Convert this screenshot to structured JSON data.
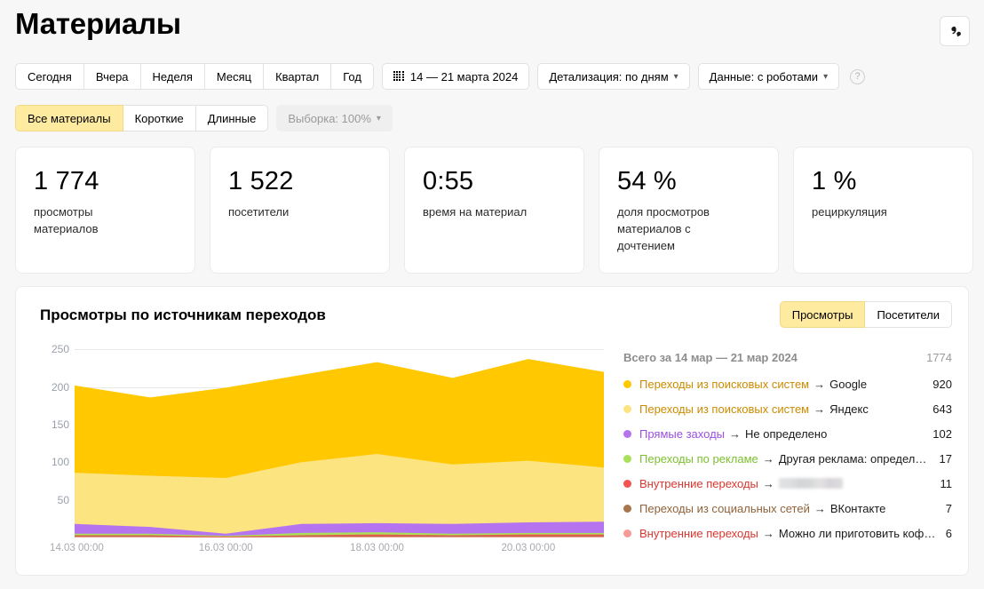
{
  "header": {
    "title": "Материалы",
    "quote_icon": "quote-icon"
  },
  "period_tabs": [
    {
      "label": "Сегодня",
      "active": false
    },
    {
      "label": "Вчера",
      "active": false
    },
    {
      "label": "Неделя",
      "active": false
    },
    {
      "label": "Месяц",
      "active": false
    },
    {
      "label": "Квартал",
      "active": false
    },
    {
      "label": "Год",
      "active": false
    }
  ],
  "date_range": {
    "icon": "calendar-icon",
    "label": "14 — 21 марта 2024"
  },
  "detail_select": {
    "label": "Детализация: по дням",
    "chevron": "chevron-down-icon"
  },
  "data_select": {
    "label": "Данные: с роботами",
    "chevron": "chevron-down-icon"
  },
  "help": {
    "icon": "help-icon",
    "glyph": "?"
  },
  "material_tabs": [
    {
      "label": "Все материалы",
      "active": true
    },
    {
      "label": "Короткие",
      "active": false
    },
    {
      "label": "Длинные",
      "active": false
    }
  ],
  "sampling": {
    "label": "Выборка: 100%",
    "chevron": "chevron-down-icon"
  },
  "kpis": [
    {
      "value": "1 774",
      "label": "просмотры материалов"
    },
    {
      "value": "1 522",
      "label": "посетители"
    },
    {
      "value": "0:55",
      "label": "время на материал"
    },
    {
      "value": "54 %",
      "label": "доля просмотров материалов с дочтением"
    },
    {
      "value": "1 %",
      "label": "рециркуляция"
    }
  ],
  "chart_card": {
    "title": "Просмотры по источникам переходов",
    "metric_tabs": [
      {
        "label": "Просмотры",
        "active": true
      },
      {
        "label": "Посетители",
        "active": false
      }
    ],
    "legend_header": {
      "label": "Всего за 14 мар — 21 мар 2024",
      "total": "1774"
    }
  },
  "chart_data": {
    "type": "area",
    "stacked": true,
    "title": "Просмотры по источникам переходов",
    "xlabel": "",
    "ylabel": "",
    "ylim": [
      0,
      262
    ],
    "yticks": [
      50,
      100,
      150,
      200,
      250
    ],
    "grid": true,
    "legend_position": "right",
    "x": [
      "14.03 00:00",
      "15.03 00:00",
      "16.03 00:00",
      "17.03 00:00",
      "18.03 00:00",
      "19.03 00:00",
      "20.03 00:00",
      "21.03 00:00"
    ],
    "xtick_labels": [
      "14.03 00:00",
      "16.03 00:00",
      "18.03 00:00",
      "20.03 00:00"
    ],
    "xtick_index": [
      0,
      2,
      4,
      6
    ],
    "series": [
      {
        "name": "Переходы из поисковых систем → Google",
        "source": "Переходы из поисковых систем",
        "dest": "Google",
        "color": "#ffc800",
        "source_color": "#cc8b00",
        "total": "920",
        "values": [
          116,
          104,
          120,
          116,
          122,
          115,
          135,
          127
        ]
      },
      {
        "name": "Переходы из поисковых систем → Яндекс",
        "source": "Переходы из поисковых систем",
        "dest": "Яндекс",
        "color": "#fce480",
        "source_color": "#cc8b00",
        "total": "643",
        "values": [
          68,
          68,
          74,
          82,
          92,
          79,
          82,
          72
        ]
      },
      {
        "name": "Прямые заходы → Не определено",
        "source": "Прямые заходы",
        "dest": "Не определено",
        "color": "#b673f0",
        "source_color": "#9a4fe0",
        "total": "102",
        "values": [
          13,
          9,
          3,
          12,
          12,
          13,
          14,
          15
        ]
      },
      {
        "name": "Переходы по рекламе → Другая реклама: определе…",
        "source": "Переходы по рекламе",
        "dest": "Другая реклама: определе…",
        "color": "#a9e05a",
        "source_color": "#7cc030",
        "total": "17",
        "values": [
          2,
          2,
          1,
          3,
          3,
          2,
          2,
          2
        ]
      },
      {
        "name": "Внутренние переходы → [скрыто]",
        "source": "Внутренние переходы",
        "dest": "",
        "dest_redacted": true,
        "color": "#f2544e",
        "source_color": "#d8372f",
        "total": "11",
        "values": [
          1,
          1,
          1,
          1,
          2,
          1,
          2,
          2
        ]
      },
      {
        "name": "Переходы из социальных сетей → ВКонтакте",
        "source": "Переходы из социальных сетей",
        "dest": "ВКонтакте",
        "color": "#a8764a",
        "source_color": "#8f6239",
        "total": "7",
        "values": [
          1,
          1,
          0,
          1,
          1,
          1,
          1,
          1
        ]
      },
      {
        "name": "Внутренние переходы → Можно ли приготовить кофе…",
        "source": "Внутренние переходы",
        "dest": "Можно ли приготовить кофе…",
        "color": "#f79a95",
        "source_color": "#d8372f",
        "total": "6",
        "values": [
          1,
          1,
          0,
          1,
          1,
          1,
          1,
          1
        ]
      }
    ]
  }
}
